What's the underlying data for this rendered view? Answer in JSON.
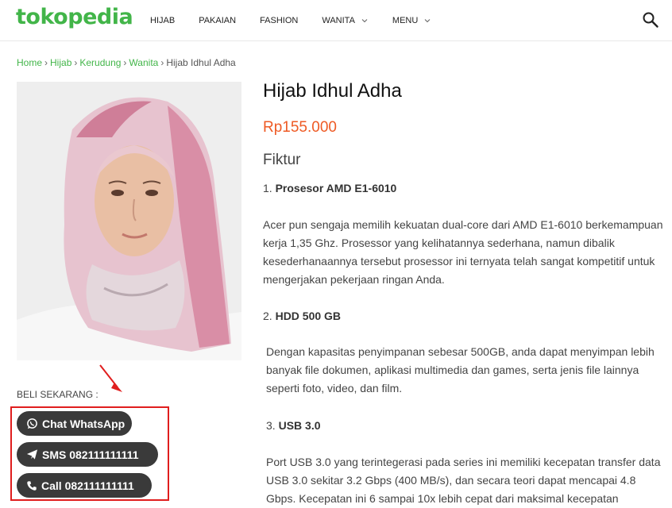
{
  "header": {
    "logo": "tokopedia",
    "nav": [
      {
        "label": "HIJAB",
        "dropdown": false
      },
      {
        "label": "PAKAIAN",
        "dropdown": false
      },
      {
        "label": "FASHION",
        "dropdown": false
      },
      {
        "label": "WANITA",
        "dropdown": true
      },
      {
        "label": "MENU",
        "dropdown": true
      }
    ],
    "search_icon": "search-icon"
  },
  "breadcrumb": {
    "items": [
      "Home",
      "Hijab",
      "Kerudung",
      "Wanita"
    ],
    "current": "Hijab Idhul Adha",
    "separator": "›"
  },
  "product": {
    "title": "Hijab Idhul Adha",
    "price": "Rp155.000"
  },
  "cta": {
    "label": "BELI SEKARANG :",
    "whatsapp": "Chat WhatsApp",
    "sms": "SMS 082111111111",
    "call": "Call 082111111111"
  },
  "description": {
    "section_title": "Fiktur",
    "items": [
      {
        "num": "1.",
        "heading": "Prosesor AMD E1-6010",
        "body": "Acer pun sengaja memilih kekuatan dual-core dari AMD E1-6010 berkemampuan kerja 1,35 Ghz. Prosessor yang kelihatannya sederhana, namun dibalik kesederhanaannya tersebut prosessor ini ternyata telah sangat kompetitif untuk mengerjakan pekerjaan ringan Anda."
      },
      {
        "num": "2.",
        "heading": "HDD 500 GB",
        "body": "Dengan kapasitas penyimpanan sebesar 500GB, anda dapat menyimpan lebih banyak file dokumen, aplikasi multimedia dan games, serta jenis file lainnya seperti foto, video, dan film."
      },
      {
        "num": "3.",
        "heading": "USB 3.0",
        "body": "Port USB 3.0 yang terintegerasi pada series ini memiliki kecepatan transfer data USB 3.0 sekitar 3.2 Gbps (400 MB/s), dan secara teori dapat mencapai 4.8 Gbps. Kecepatan ini 6 sampai 10x lebih cepat dari maksimal kecepatan"
      }
    ]
  },
  "colors": {
    "brand_green": "#42b549",
    "price_orange": "#ee5a24",
    "button_dark": "#3a3a3a",
    "highlight_red": "#e01e1e"
  }
}
